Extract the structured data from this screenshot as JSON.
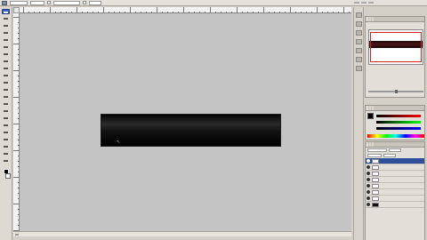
{
  "options_bar": {
    "fields": [
      "",
      "",
      "",
      ""
    ],
    "labels": [],
    "right_tabs": [
      "",
      "",
      ""
    ]
  },
  "toolbox": {
    "active_tool": "move-tool",
    "tool_count": 22
  },
  "document": {
    "zoom": "",
    "status": "",
    "shape_fill": "#000000"
  },
  "navigator": {
    "tabs": [
      "",
      "",
      ""
    ]
  },
  "color_panel": {
    "tabs": [
      "",
      "",
      ""
    ],
    "foreground_color": "#000000"
  },
  "layers_panel": {
    "tabs": [
      "",
      "",
      ""
    ],
    "layers": [
      {
        "name": "",
        "selected": true,
        "thumb": "light"
      },
      {
        "name": "",
        "selected": false,
        "thumb": "light"
      },
      {
        "name": "",
        "selected": false,
        "thumb": "light"
      },
      {
        "name": "",
        "selected": false,
        "thumb": "light"
      },
      {
        "name": "",
        "selected": false,
        "thumb": "light"
      },
      {
        "name": "",
        "selected": false,
        "thumb": "light"
      },
      {
        "name": "",
        "selected": false,
        "thumb": "light"
      },
      {
        "name": "",
        "selected": false,
        "thumb": "dark"
      }
    ]
  }
}
